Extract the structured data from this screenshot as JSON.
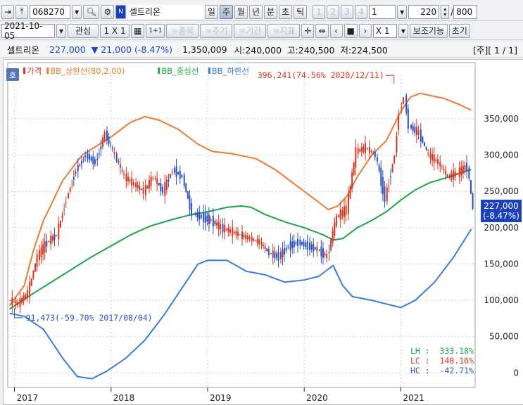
{
  "toolbar1": {
    "code": "068270",
    "stock_name": "셀트리온",
    "periods": [
      "일",
      "주",
      "월",
      "년",
      "분",
      "초",
      "틱"
    ],
    "selected_period": "주",
    "minute_buttons": [
      "1",
      "2",
      "3",
      "4"
    ],
    "minute_value": "1",
    "count": "220",
    "total": "800"
  },
  "toolbar2": {
    "date": "2021-10-05",
    "interest": "관심",
    "layout": "1 X 1",
    "one_plus_one": "1+1",
    "item_btn": "=종목",
    "period_btn": "=주기",
    "range_btn": "=기간",
    "indicator_btn": "=지표",
    "zoom_value": "X 1",
    "aux_btn": "보조기능",
    "reset_btn": "초기"
  },
  "info": {
    "name": "셀트리온",
    "price": "227,000",
    "change": "▼ 21,000 (-8.47%)",
    "volume": "1,350,009",
    "open": "시:240,000",
    "high": "고:240,500",
    "low": "저:224,500",
    "page": "[주][ 1 / 1]"
  },
  "chart_data": {
    "type": "line",
    "tab_label": "호",
    "legend": [
      "가격",
      "BB_상한선(80,2.00)",
      "BB_중심선",
      "BB_하한선"
    ],
    "colors": {
      "price_up": "#d9341f",
      "price_down": "#2d4fbf",
      "upper": "#ef7a2e",
      "middle": "#1ea546",
      "lower": "#3a7ae0",
      "label_price_bg": "#1c3fbb"
    },
    "x_ticks": [
      "2017",
      "2018",
      "2019",
      "2020",
      "2021"
    ],
    "y_ticks": [
      0,
      50000,
      100000,
      150000,
      200000,
      250000,
      300000,
      350000
    ],
    "y_tick_labels": [
      "0",
      "50,000",
      "100,000",
      "150,000",
      "200,000",
      "250,000",
      "300,000",
      "350,000"
    ],
    "ylim": [
      -20000,
      410000
    ],
    "xlim": [
      2016.93,
      2021.77
    ],
    "series": [
      {
        "name": "가격",
        "points": [
          [
            2016.95,
            100000
          ],
          [
            2017.05,
            95000
          ],
          [
            2017.15,
            110000
          ],
          [
            2017.25,
            160000
          ],
          [
            2017.35,
            180000
          ],
          [
            2017.45,
            190000
          ],
          [
            2017.55,
            240000
          ],
          [
            2017.65,
            280000
          ],
          [
            2017.75,
            300000
          ],
          [
            2017.85,
            290000
          ],
          [
            2017.95,
            330000
          ],
          [
            2018.05,
            300000
          ],
          [
            2018.15,
            270000
          ],
          [
            2018.25,
            260000
          ],
          [
            2018.35,
            250000
          ],
          [
            2018.45,
            270000
          ],
          [
            2018.55,
            250000
          ],
          [
            2018.65,
            280000
          ],
          [
            2018.75,
            270000
          ],
          [
            2018.85,
            220000
          ],
          [
            2018.95,
            215000
          ],
          [
            2019.05,
            210000
          ],
          [
            2019.15,
            200000
          ],
          [
            2019.25,
            195000
          ],
          [
            2019.35,
            190000
          ],
          [
            2019.45,
            185000
          ],
          [
            2019.55,
            180000
          ],
          [
            2019.65,
            165000
          ],
          [
            2019.75,
            160000
          ],
          [
            2019.85,
            175000
          ],
          [
            2019.95,
            180000
          ],
          [
            2020.05,
            175000
          ],
          [
            2020.15,
            170000
          ],
          [
            2020.25,
            160000
          ],
          [
            2020.35,
            215000
          ],
          [
            2020.45,
            225000
          ],
          [
            2020.55,
            305000
          ],
          [
            2020.65,
            310000
          ],
          [
            2020.75,
            300000
          ],
          [
            2020.85,
            240000
          ],
          [
            2020.95,
            300000
          ],
          [
            2021.0,
            360000
          ],
          [
            2021.05,
            380000
          ],
          [
            2021.1,
            340000
          ],
          [
            2021.2,
            330000
          ],
          [
            2021.3,
            300000
          ],
          [
            2021.4,
            290000
          ],
          [
            2021.5,
            270000
          ],
          [
            2021.6,
            275000
          ],
          [
            2021.7,
            285000
          ],
          [
            2021.76,
            227000
          ]
        ]
      },
      {
        "name": "BB_상한선(80,2.00)",
        "points": [
          [
            2016.95,
            93000
          ],
          [
            2017.1,
            120000
          ],
          [
            2017.2,
            170000
          ],
          [
            2017.3,
            210000
          ],
          [
            2017.5,
            265000
          ],
          [
            2017.7,
            300000
          ],
          [
            2018.0,
            325000
          ],
          [
            2018.2,
            345000
          ],
          [
            2018.35,
            353000
          ],
          [
            2018.5,
            348000
          ],
          [
            2018.7,
            335000
          ],
          [
            2018.9,
            315000
          ],
          [
            2019.05,
            305000
          ],
          [
            2019.25,
            302000
          ],
          [
            2019.5,
            295000
          ],
          [
            2019.7,
            280000
          ],
          [
            2019.9,
            260000
          ],
          [
            2020.1,
            240000
          ],
          [
            2020.25,
            225000
          ],
          [
            2020.35,
            230000
          ],
          [
            2020.45,
            245000
          ],
          [
            2020.55,
            270000
          ],
          [
            2020.7,
            300000
          ],
          [
            2020.85,
            320000
          ],
          [
            2021.0,
            360000
          ],
          [
            2021.1,
            380000
          ],
          [
            2021.2,
            385000
          ],
          [
            2021.45,
            378000
          ],
          [
            2021.6,
            370000
          ],
          [
            2021.73,
            362000
          ]
        ]
      },
      {
        "name": "BB_중심선",
        "points": [
          [
            2016.95,
            88000
          ],
          [
            2017.2,
            110000
          ],
          [
            2017.5,
            135000
          ],
          [
            2017.8,
            160000
          ],
          [
            2018.0,
            175000
          ],
          [
            2018.2,
            190000
          ],
          [
            2018.4,
            202000
          ],
          [
            2018.6,
            210000
          ],
          [
            2018.8,
            217000
          ],
          [
            2019.0,
            222000
          ],
          [
            2019.2,
            228000
          ],
          [
            2019.35,
            230000
          ],
          [
            2019.45,
            228000
          ],
          [
            2019.6,
            218000
          ],
          [
            2019.8,
            208000
          ],
          [
            2020.0,
            200000
          ],
          [
            2020.2,
            190000
          ],
          [
            2020.3,
            183000
          ],
          [
            2020.4,
            185000
          ],
          [
            2020.55,
            200000
          ],
          [
            2020.7,
            210000
          ],
          [
            2020.85,
            222000
          ],
          [
            2021.0,
            238000
          ],
          [
            2021.15,
            252000
          ],
          [
            2021.3,
            262000
          ],
          [
            2021.5,
            270000
          ],
          [
            2021.73,
            280000
          ]
        ]
      },
      {
        "name": "BB_하한선",
        "points": [
          [
            2016.95,
            82000
          ],
          [
            2017.1,
            78000
          ],
          [
            2017.3,
            60000
          ],
          [
            2017.5,
            20000
          ],
          [
            2017.65,
            -5000
          ],
          [
            2017.8,
            -8000
          ],
          [
            2017.95,
            2000
          ],
          [
            2018.15,
            20000
          ],
          [
            2018.35,
            45000
          ],
          [
            2018.55,
            80000
          ],
          [
            2018.75,
            120000
          ],
          [
            2018.9,
            150000
          ],
          [
            2019.0,
            155000
          ],
          [
            2019.2,
            155000
          ],
          [
            2019.4,
            140000
          ],
          [
            2019.6,
            135000
          ],
          [
            2019.8,
            125000
          ],
          [
            2020.0,
            128000
          ],
          [
            2020.15,
            133000
          ],
          [
            2020.3,
            148000
          ],
          [
            2020.4,
            120000
          ],
          [
            2020.5,
            105000
          ],
          [
            2020.7,
            100000
          ],
          [
            2020.85,
            95000
          ],
          [
            2021.0,
            90000
          ],
          [
            2021.15,
            100000
          ],
          [
            2021.35,
            125000
          ],
          [
            2021.55,
            160000
          ],
          [
            2021.73,
            198000
          ]
        ]
      }
    ],
    "annotations": [
      {
        "text": "396,241(74.56% 2020/12/11)",
        "x": 2020.93,
        "y": 396241
      },
      {
        "text": "91,473(-59.70% 2017/08/04)",
        "x": 2017.0,
        "y": 91473
      }
    ],
    "last_price_label": [
      "227,000",
      "(-8.47%)"
    ],
    "stats": [
      {
        "label": "LH",
        "value": "333.18%",
        "color": "#1ea546"
      },
      {
        "label": "LC",
        "value": "148.16%",
        "color": "#d9341f"
      },
      {
        "label": "HC",
        "value": "-42.71%",
        "color": "#2d4fbf"
      }
    ]
  }
}
